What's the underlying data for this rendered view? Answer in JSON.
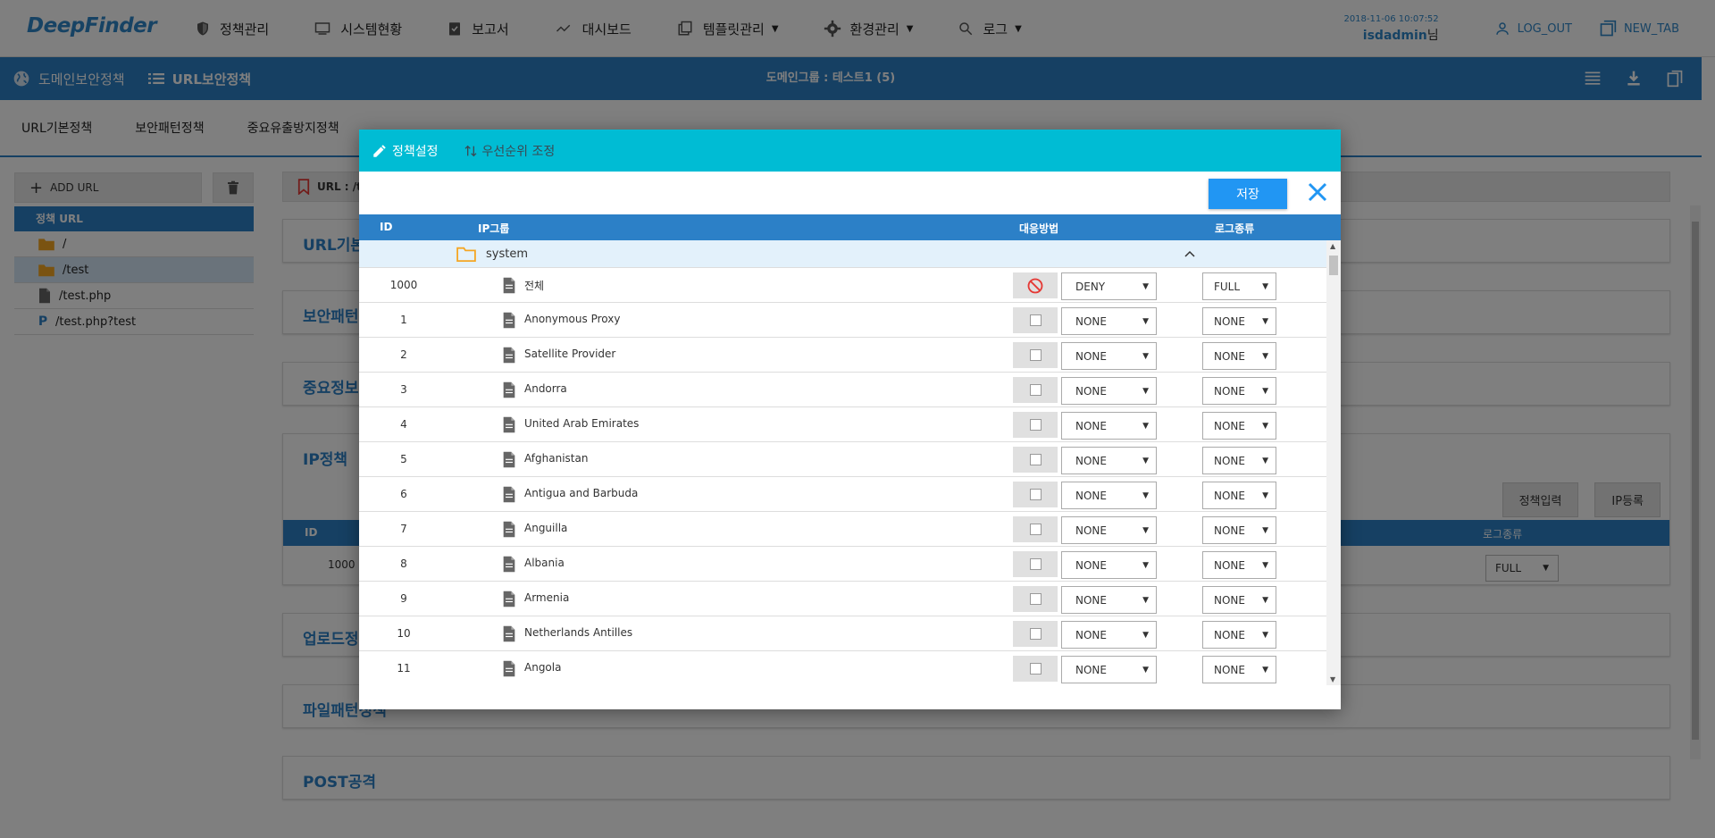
{
  "app": {
    "logo": "DeepFinder"
  },
  "nav": {
    "items": [
      {
        "label": "정책관리",
        "icon": "shield-icon",
        "caret": false
      },
      {
        "label": "시스템현황",
        "icon": "monitor-icon",
        "caret": false
      },
      {
        "label": "보고서",
        "icon": "clipboard-check-icon",
        "caret": false
      },
      {
        "label": "대시보드",
        "icon": "trend-chart-icon",
        "caret": false
      },
      {
        "label": "템플릿관리",
        "icon": "library-icon",
        "caret": true
      },
      {
        "label": "환경관리",
        "icon": "gear-icon",
        "caret": true
      },
      {
        "label": "로그",
        "icon": "search-icon",
        "caret": true
      }
    ]
  },
  "user": {
    "timestamp": "2018-11-06 10:07:52",
    "name": "isdadmin",
    "suffix": "님"
  },
  "top_links": {
    "logout": "LOG_OUT",
    "new_tab": "NEW_TAB"
  },
  "subheader": {
    "crumb1": "도메인보안정책",
    "crumb2": "URL보안정책",
    "domain_group": "도메인그룹 : 테스트1 (5)"
  },
  "tabs": [
    "URL기본정책",
    "보안패턴정책",
    "중요유출방지정책"
  ],
  "left": {
    "add_url": "ADD URL",
    "tree_header": "정책 URL",
    "tree": [
      {
        "label": "/",
        "type": "folder",
        "selected": false
      },
      {
        "label": "/test",
        "type": "folder",
        "selected": true
      },
      {
        "label": "/test.php",
        "type": "file",
        "selected": false
      },
      {
        "label": "/test.php?test",
        "type": "param",
        "selected": false
      }
    ]
  },
  "main": {
    "url_label": "URL : /te",
    "sections": {
      "s1": "URL기본",
      "s2": "보안패턴",
      "s3": "중요정보",
      "s4": "IP정책",
      "s5": "업로드정",
      "s6": "파일패턴정책",
      "s7": "POST공격"
    },
    "ip_actions": {
      "policy_input": "정책입력",
      "ip_register": "IP등록"
    },
    "ip_table": {
      "col_id": "ID",
      "col_log": "로그종류",
      "row_id": "1000",
      "row_log": "FULL"
    }
  },
  "modal": {
    "tab_active": "정책설정",
    "tab_inactive": "우선순위 조정",
    "save": "저장",
    "columns": {
      "id": "ID",
      "ip_group": "IP그룹",
      "action": "대응방법",
      "log": "로그종류"
    },
    "group": "system",
    "rows": [
      {
        "id": "1000",
        "name": "전체",
        "deny": true,
        "action": "DENY",
        "log": "FULL"
      },
      {
        "id": "1",
        "name": "Anonymous Proxy",
        "deny": false,
        "action": "NONE",
        "log": "NONE"
      },
      {
        "id": "2",
        "name": "Satellite Provider",
        "deny": false,
        "action": "NONE",
        "log": "NONE"
      },
      {
        "id": "3",
        "name": "Andorra",
        "deny": false,
        "action": "NONE",
        "log": "NONE"
      },
      {
        "id": "4",
        "name": "United Arab Emirates",
        "deny": false,
        "action": "NONE",
        "log": "NONE"
      },
      {
        "id": "5",
        "name": "Afghanistan",
        "deny": false,
        "action": "NONE",
        "log": "NONE"
      },
      {
        "id": "6",
        "name": "Antigua and Barbuda",
        "deny": false,
        "action": "NONE",
        "log": "NONE"
      },
      {
        "id": "7",
        "name": "Anguilla",
        "deny": false,
        "action": "NONE",
        "log": "NONE"
      },
      {
        "id": "8",
        "name": "Albania",
        "deny": false,
        "action": "NONE",
        "log": "NONE"
      },
      {
        "id": "9",
        "name": "Armenia",
        "deny": false,
        "action": "NONE",
        "log": "NONE"
      },
      {
        "id": "10",
        "name": "Netherlands Antilles",
        "deny": false,
        "action": "NONE",
        "log": "NONE"
      },
      {
        "id": "11",
        "name": "Angola",
        "deny": false,
        "action": "NONE",
        "log": "NONE"
      }
    ]
  },
  "colors": {
    "primary": "#2c80c7",
    "modal_header": "#00bcd4",
    "save_button": "#2196f3",
    "deny_icon": "#e53935",
    "folder": "#f5a623"
  }
}
